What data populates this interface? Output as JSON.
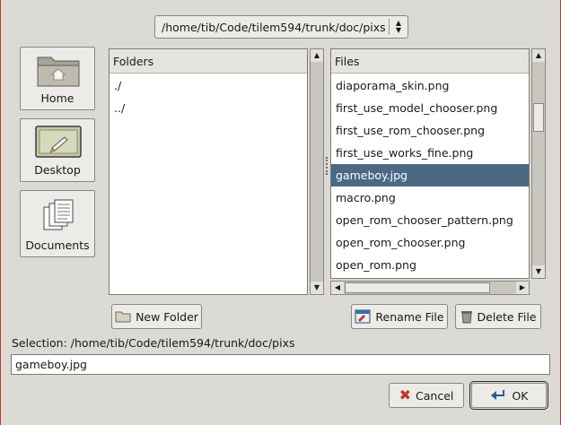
{
  "path_combo": {
    "value": "/home/tib/Code/tilem594/trunk/doc/pixs"
  },
  "shortcuts": [
    {
      "label": "Home",
      "icon": "folder-home-icon"
    },
    {
      "label": "Desktop",
      "icon": "desktop-icon"
    },
    {
      "label": "Documents",
      "icon": "documents-icon"
    }
  ],
  "folders": {
    "header": "Folders",
    "items": [
      "./",
      "../"
    ]
  },
  "files": {
    "header": "Files",
    "items": [
      "diaporama_skin.png",
      "first_use_model_chooser.png",
      "first_use_rom_chooser.png",
      "first_use_works_fine.png",
      "gameboy.jpg",
      "macro.png",
      "open_rom_chooser_pattern.png",
      "open_rom_chooser.png",
      "open_rom.png"
    ],
    "selected": "gameboy.jpg"
  },
  "buttons": {
    "new_folder": "New Folder",
    "rename_file": "Rename File",
    "delete_file": "Delete File",
    "cancel": "Cancel",
    "ok": "OK"
  },
  "selection": {
    "label": "Selection: /home/tib/Code/tilem594/trunk/doc/pixs",
    "value": "gameboy.jpg"
  },
  "colors": {
    "selection": "#4b6983",
    "background": "#dcdad5",
    "cancel_icon": "#c0392b"
  }
}
